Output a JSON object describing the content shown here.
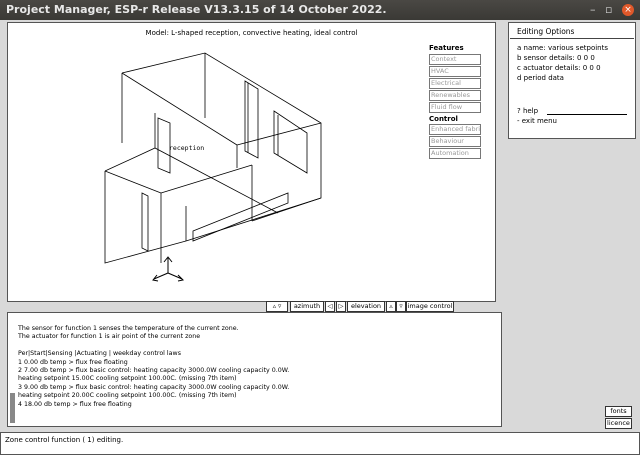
{
  "window": {
    "title": "Project Manager, ESP-r Release V13.3.15 of 14 October 2022.",
    "controls": {
      "minimize": "–",
      "maximize": "▫",
      "close": "×"
    }
  },
  "view": {
    "title": "Model: L-shaped reception, convective heating, ideal control",
    "zone_label": "reception"
  },
  "features": {
    "heading": "Features",
    "items": [
      {
        "label": "Context",
        "active": false
      },
      {
        "label": "HVAC",
        "active": false
      },
      {
        "label": "Electrical",
        "active": false
      },
      {
        "label": "Renewables",
        "active": false
      },
      {
        "label": "Fluid flow",
        "active": false
      }
    ],
    "control_label": "Control",
    "items2": [
      {
        "label": "Enhanced fabric",
        "active": false
      },
      {
        "label": "Behaviour",
        "active": false
      },
      {
        "label": "Automation",
        "active": false
      }
    ]
  },
  "toolbar": {
    "zoom_arrows": "▵ ▿",
    "azimuth": "azimuth",
    "az_left": "◁",
    "az_right": "▷",
    "elevation": "elevation",
    "el_btn": "▵",
    "el_btn2": "▿",
    "image_control": "image control"
  },
  "text_output": {
    "lines": [
      "The sensor for function  1 senses the temperature of the current zone.",
      "The actuator for function  1 is air point of the current zone",
      "",
      "Per|Start|Sensing  |Actuating  | weekday control laws",
      "  1  0.00 db temp  > flux    free floating",
      "  2  7.00 db temp  > flux    basic control: heating capacity 3000.0W cooling capacity 0.0W.",
      "heating setpoint 15.00C cooling setpoint 100.00C. (missing 7th item)",
      "  3  9.00 db temp  > flux    basic control: heating capacity 3000.0W cooling capacity 0.0W.",
      "heating setpoint 20.00C cooling setpoint 100.00C. (missing 7th item)",
      "  4 18.00 db temp  > flux    free floating"
    ]
  },
  "editing": {
    "heading": "Editing Options",
    "opt_a": "a name: various setpoints",
    "opt_b": "b sensor details:  0  0  0",
    "opt_c": "c actuator details:  0  0  0",
    "opt_d": "d period data",
    "help": "? help",
    "exit": "- exit menu"
  },
  "buttons": {
    "fonts": "fonts",
    "licence": "licence"
  },
  "status": {
    "message": "Zone control function ( 1) editing."
  }
}
